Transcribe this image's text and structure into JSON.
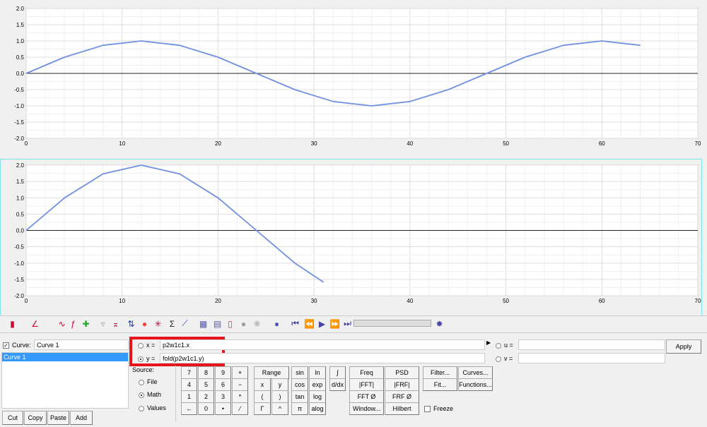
{
  "chart_data": [
    {
      "type": "line",
      "xlim": [
        0,
        70
      ],
      "ylim": [
        -2,
        2
      ],
      "grid": true,
      "xticks": [
        "0",
        "10",
        "20",
        "30",
        "40",
        "50",
        "60",
        "70"
      ],
      "yticks": [
        "2.0",
        "1.5",
        "1.0",
        "0.5",
        "0.0",
        "-0.5",
        "-1.0",
        "-1.5",
        "-2.0"
      ],
      "series": [
        {
          "color": "#7090e0",
          "x": [
            0,
            4,
            8,
            12,
            16,
            20,
            24,
            28,
            32,
            36,
            40,
            44,
            48,
            52,
            56,
            60,
            64
          ],
          "y": [
            0,
            0.5,
            0.866,
            1,
            0.866,
            0.5,
            0,
            -0.5,
            -0.866,
            -1,
            -0.866,
            -0.5,
            0,
            0.5,
            0.866,
            1,
            0.866
          ]
        }
      ]
    },
    {
      "type": "line",
      "xlim": [
        0,
        70
      ],
      "ylim": [
        -2,
        2
      ],
      "grid": true,
      "xticks": [
        "0",
        "10",
        "20",
        "30",
        "40",
        "50",
        "60",
        "70"
      ],
      "yticks": [
        "2.0",
        "1.5",
        "1.0",
        "0.5",
        "0.0",
        "-0.5",
        "-1.0",
        "-1.5",
        "-2.0"
      ],
      "series": [
        {
          "color": "#7090e0",
          "x": [
            0,
            4,
            8,
            12,
            16,
            20,
            24,
            28,
            31
          ],
          "y": [
            0,
            1,
            1.732,
            2,
            1.732,
            1,
            0,
            -1,
            -1.587
          ]
        }
      ]
    }
  ],
  "toolbar": {
    "icons": [
      "curve-type-icon",
      "axis-icon",
      "function-icon",
      "fx-icon",
      "add-point-icon",
      "marker-icon",
      "peak-icon",
      "cursor-icon",
      "color-wheel-icon",
      "crosshair-icon",
      "sigma-icon",
      "trend-icon",
      "grid-icon",
      "legend-icon",
      "page-icon",
      "note-icon",
      "settings-gear-icon",
      "animation-icon",
      "first-frame-icon",
      "prev-frame-icon",
      "play-icon",
      "next-frame-icon",
      "last-frame-icon",
      "options-icon"
    ]
  },
  "curve": {
    "checkbox_label": "Curve:",
    "name": "Curve 1",
    "list": [
      "Curve 1"
    ],
    "cut": "Cut",
    "copy": "Copy",
    "paste": "Paste",
    "add": "Add"
  },
  "expr": {
    "x_label": "x =",
    "x_value": "p2w1c1.x",
    "y_label": "y =",
    "y_value": "fold(p2w1c1.y)",
    "u_label": "u =",
    "u_value": "",
    "v_label": "v =",
    "v_value": "",
    "apply": "Apply",
    "selected": "y"
  },
  "source": {
    "label": "Source:",
    "options": [
      "File",
      "Math",
      "Values"
    ],
    "selected": "Math"
  },
  "keypad": [
    "7",
    "8",
    "9",
    "+",
    "4",
    "5",
    "6",
    "−",
    "1",
    "2",
    "3",
    "*",
    "←",
    "0",
    "•",
    "⁄"
  ],
  "ops": [
    "Range",
    "x",
    "y",
    "(",
    ")",
    "Γ",
    "^"
  ],
  "funcs": [
    "sin",
    "ln",
    "cos",
    "exp",
    "tan",
    "log",
    "π",
    "alog"
  ],
  "calc": [
    "∫",
    "d/dx"
  ],
  "signal": [
    "Freq",
    "PSD",
    "|FFT|",
    "|FRF|",
    "FFT Ø",
    "FRF Ø",
    "Window...",
    "Hilbert"
  ],
  "tools": [
    "Filter...",
    "Curves...",
    "Fit...",
    "Functions..."
  ],
  "freeze": "Freeze",
  "colors": {
    "highlight": "#3399ff",
    "curve": "#7090e0",
    "annotation": "#ff0000"
  }
}
